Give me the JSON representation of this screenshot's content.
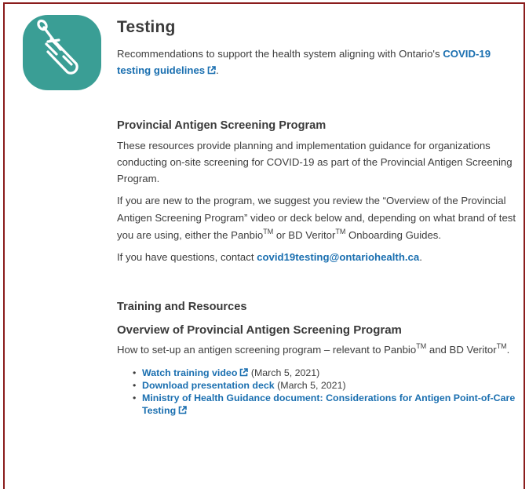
{
  "section": {
    "title": "Testing",
    "intro_text": "Recommendations to support the health system aligning with Ontario's ",
    "intro_link": "COVID-19 testing guidelines",
    "intro_end": "."
  },
  "program": {
    "heading": "Provincial Antigen Screening Program",
    "para1": "These resources provide planning and implementation guidance for organizations conducting on-site screening for COVID-19 as part of the Provincial Antigen Screening Program.",
    "para2_a": "If you are new to the program, we suggest you review the “Overview of the Provincial Antigen Screening Program” video or deck below and, depending on what brand of test you are using, either the Panbio",
    "para2_tm1": "TM",
    "para2_b": " or BD Veritor",
    "para2_tm2": "TM",
    "para2_c": " Onboarding Guides.",
    "para3_a": "If you have questions, contact ",
    "para3_email": "covid19testing@ontariohealth.ca",
    "para3_end": "."
  },
  "training": {
    "heading": "Training and Resources",
    "subheading": "Overview of Provincial Antigen Screening Program",
    "desc_a": "How to set-up an antigen screening program – relevant to Panbio",
    "desc_tm1": "TM",
    "desc_b": " and BD Veritor",
    "desc_tm2": "TM",
    "desc_end": ".",
    "items": [
      {
        "link": "Watch training video",
        "note": " (March 5, 2021)",
        "external": true
      },
      {
        "link": "Download presentation deck",
        "note": " (March 5, 2021)",
        "external": false
      },
      {
        "link": "Ministry of Health Guidance document: Considerations for Antigen Point-of-Care Testing",
        "note": "",
        "external": true
      }
    ]
  },
  "icons": {
    "logo": "test-tube-swab-icon",
    "external": "external-link-icon"
  },
  "colors": {
    "logo_bg": "#3a9e95",
    "link": "#1a6fb0",
    "border": "#8a1c1c"
  }
}
